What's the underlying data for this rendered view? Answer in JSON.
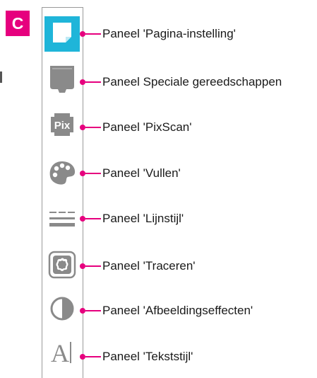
{
  "badge": {
    "label": "C"
  },
  "panels": [
    {
      "icon": "page-setup-icon",
      "label": "Paneel 'Pagina-instelling'",
      "active": true
    },
    {
      "icon": "special-tools-icon",
      "label": "Paneel Speciale gereedschappen",
      "active": false
    },
    {
      "icon": "pixscan-icon",
      "label": "Paneel 'PixScan'",
      "icon_text": "Pix",
      "active": false
    },
    {
      "icon": "palette-icon",
      "label": "Paneel 'Vullen'",
      "active": false
    },
    {
      "icon": "line-style-icon",
      "label": "Paneel 'Lijnstijl'",
      "active": false
    },
    {
      "icon": "trace-icon",
      "label": "Paneel 'Traceren'",
      "active": false
    },
    {
      "icon": "contrast-icon",
      "label": "Paneel 'Afbeeldingseffecten'",
      "active": false
    },
    {
      "icon": "text-style-icon",
      "label": "Paneel 'Tekststijl'",
      "icon_text": "A",
      "active": false
    }
  ],
  "colors": {
    "accent": "#e6007e",
    "active_tool": "#1fb5d9",
    "icon_gray": "#8a8a8a"
  }
}
